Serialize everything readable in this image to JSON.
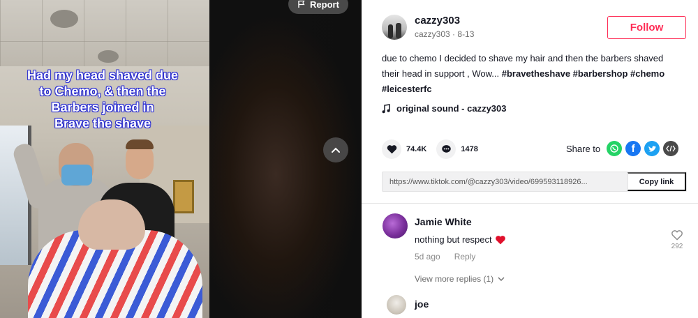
{
  "video": {
    "caption": "Had my head shaved due\nto Chemo, & then the\nBarbers joined in\nBrave the shave",
    "report_label": "Report"
  },
  "author": {
    "username": "cazzy303",
    "handle": "cazzy303",
    "date": "8-13",
    "follow_label": "Follow"
  },
  "description": {
    "text": "due to chemo I decided to shave my hair and then the barbers shaved their head in support , Wow...",
    "hashtags": [
      "#bravetheshave",
      "#barbershop",
      "#chemo",
      "#leicesterfc"
    ]
  },
  "sound": {
    "label": "original sound - cazzy303"
  },
  "stats": {
    "likes": "74.4K",
    "comments": "1478"
  },
  "share": {
    "label": "Share to",
    "targets": [
      "whatsapp-icon",
      "facebook-icon",
      "twitter-icon",
      "embed-icon"
    ],
    "colors": {
      "whatsapp": "#25d366",
      "facebook": "#1877f2",
      "twitter": "#1da1f2",
      "embed": "#4a4a4a"
    }
  },
  "link": {
    "url": "https://www.tiktok.com/@cazzy303/video/699593118926...",
    "copy_label": "Copy link"
  },
  "comments": [
    {
      "name": "Jamie White",
      "text": "nothing but respect",
      "time": "5d ago",
      "reply_label": "Reply",
      "likes": "292",
      "view_replies": "View more replies (1)"
    },
    {
      "name": "joe"
    }
  ],
  "accent_color": "#fe2c55"
}
